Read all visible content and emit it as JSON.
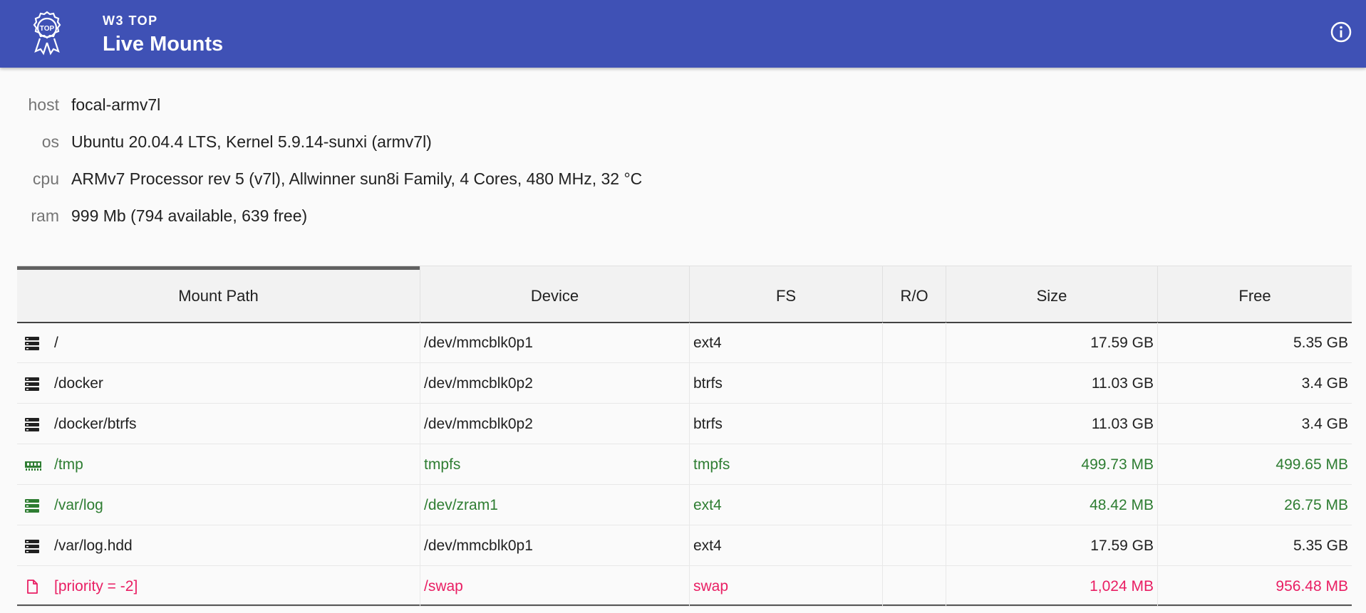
{
  "app": {
    "subtitle": "W3 TOP",
    "title": "Live Mounts"
  },
  "info_icon": "info-circle-icon",
  "props": [
    {
      "key": "host",
      "value": "focal-armv7l"
    },
    {
      "key": "os",
      "value": "Ubuntu 20.04.4 LTS, Kernel 5.9.14-sunxi (armv7l)"
    },
    {
      "key": "cpu",
      "value": "ARMv7 Processor rev 5 (v7l), Allwinner sun8i Family, 4 Cores, 480 MHz, 32 °C"
    },
    {
      "key": "ram",
      "value": "999 Mb (794 available, 639 free)"
    }
  ],
  "table": {
    "headers": [
      "Mount Path",
      "Device",
      "FS",
      "R/O",
      "Size",
      "Free"
    ],
    "sorted_column": "Mount Path",
    "rows": [
      {
        "icon": "storage-icon",
        "path": "/",
        "device": "/dev/mmcblk0p1",
        "fs": "ext4",
        "ro": "",
        "size": "17.59 GB",
        "free": "5.35 GB",
        "color": "#212121"
      },
      {
        "icon": "storage-icon",
        "path": "/docker",
        "device": "/dev/mmcblk0p2",
        "fs": "btrfs",
        "ro": "",
        "size": "11.03 GB",
        "free": "3.4 GB",
        "color": "#212121"
      },
      {
        "icon": "storage-icon",
        "path": "/docker/btrfs",
        "device": "/dev/mmcblk0p2",
        "fs": "btrfs",
        "ro": "",
        "size": "11.03 GB",
        "free": "3.4 GB",
        "color": "#212121"
      },
      {
        "icon": "memory-icon",
        "path": "/tmp",
        "device": "tmpfs",
        "fs": "tmpfs",
        "ro": "",
        "size": "499.73 MB",
        "free": "499.65 MB",
        "color": "#2e7d32"
      },
      {
        "icon": "storage-icon",
        "path": "/var/log",
        "device": "/dev/zram1",
        "fs": "ext4",
        "ro": "",
        "size": "48.42 MB",
        "free": "26.75 MB",
        "color": "#2e7d32"
      },
      {
        "icon": "storage-icon",
        "path": "/var/log.hdd",
        "device": "/dev/mmcblk0p1",
        "fs": "ext4",
        "ro": "",
        "size": "17.59 GB",
        "free": "5.35 GB",
        "color": "#212121"
      },
      {
        "icon": "file-icon",
        "path": "[priority = -2]",
        "device": "/swap",
        "fs": "swap",
        "ro": "",
        "size": "1,024 MB",
        "free": "956.48 MB",
        "color": "#e91e63"
      }
    ]
  },
  "colors": {
    "appbar": "#3f51b5",
    "green": "#2e7d32",
    "pink": "#e91e63"
  }
}
